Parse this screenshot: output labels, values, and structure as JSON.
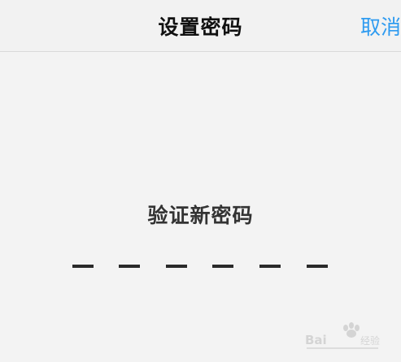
{
  "nav": {
    "title": "设置密码",
    "cancel_label": "取消"
  },
  "prompt": {
    "label": "验证新密码"
  },
  "pin": {
    "length": 6,
    "entered": 0
  },
  "colors": {
    "accent": "#2f9bf0",
    "background": "#f3f3f3",
    "text": "#111111"
  }
}
